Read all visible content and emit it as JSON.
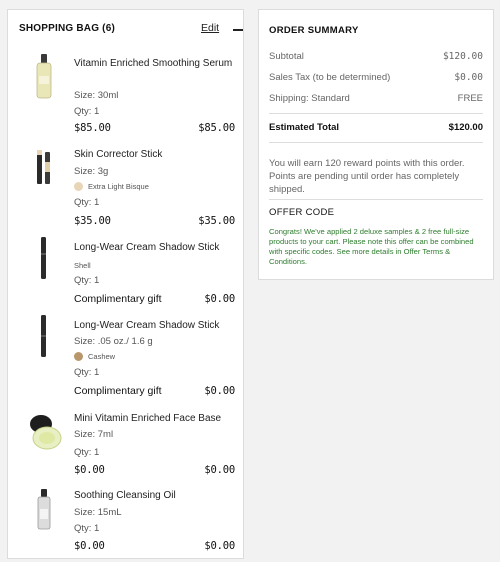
{
  "bag": {
    "title": "SHOPPING BAG (6)",
    "edit_label": "Edit",
    "items": [
      {
        "name": "Vitamin Enriched Smoothing Serum",
        "size": "Size: 30ml",
        "shade": "",
        "qty": "Qty: 1",
        "price": "$85.00",
        "total": "$85.00",
        "icon": "serum-bottle-icon"
      },
      {
        "name": "Skin Corrector Stick",
        "size": "Size: 3g",
        "shade": "Extra Light Bisque",
        "shade_color": "#e8d5b7",
        "qty": "Qty: 1",
        "price": "$35.00",
        "total": "$35.00",
        "icon": "corrector-stick-icon"
      },
      {
        "name": "Long-Wear Cream Shadow Stick",
        "size": "",
        "shade": "Shell",
        "qty": "Qty: 1",
        "price": "Complimentary gift",
        "total": "$0.00",
        "icon": "shadow-stick-icon"
      },
      {
        "name": "Long-Wear Cream Shadow Stick",
        "size": "Size: .05 oz./ 1.6 g",
        "shade": "Cashew",
        "shade_color": "#b8976c",
        "qty": "Qty: 1",
        "price": "Complimentary gift",
        "total": "$0.00",
        "icon": "shadow-stick-icon"
      },
      {
        "name": "Mini Vitamin Enriched Face Base",
        "size": "Size: 7ml",
        "shade": "",
        "qty": "Qty: 1",
        "price": "$0.00",
        "total": "$0.00",
        "icon": "face-base-jar-icon"
      },
      {
        "name": "Soothing Cleansing Oil",
        "size": "Size: 15mL",
        "shade": "",
        "qty": "Qty: 1",
        "price": "$0.00",
        "total": "$0.00",
        "icon": "oil-bottle-icon"
      }
    ]
  },
  "summary": {
    "title": "ORDER SUMMARY",
    "subtotal_label": "Subtotal",
    "subtotal": "$120.00",
    "tax_label": "Sales Tax (to be determined)",
    "tax": "$0.00",
    "shipping_label": "Shipping: Standard",
    "shipping": "FREE",
    "estimated_label": "Estimated Total",
    "estimated": "$120.00",
    "reward_text": "You will earn 120 reward points with this order. Points are pending until order has completely shipped.",
    "offer_title": "OFFER CODE",
    "offer_text": "Congrats! We've applied 2 deluxe samples & 2 free full-size products to your cart. Please note this offer can be combined with specific codes. See more details in Offer Terms & Conditions."
  },
  "colors": {
    "offer_green": "#2f7d2f",
    "border": "#dcdcdc"
  }
}
